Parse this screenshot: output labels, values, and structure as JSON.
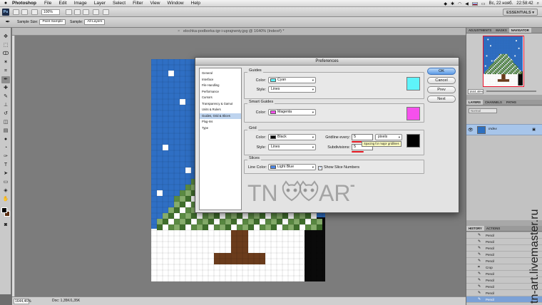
{
  "menubar": {
    "apple": "",
    "app_name": "Photoshop",
    "items": [
      "File",
      "Edit",
      "Image",
      "Layer",
      "Select",
      "Filter",
      "View",
      "Window",
      "Help"
    ],
    "status_right": [
      "Вс, 22 нояб.",
      "22:58:42"
    ]
  },
  "appbar": {
    "logo": "Ps",
    "zoom": "100%",
    "workspace": "ESSENTIALS ▾"
  },
  "options_bar": {
    "sample_size_label": "Sample Size:",
    "sample_size_value": "Point Sample",
    "sample_label": "Sample:",
    "sample_value": "All Layers"
  },
  "document": {
    "tab_title": "elochka-podborka-igr-i-uprajneniy.jpg @ 1640% (Index#) *",
    "status_zoom": "1644,46%",
    "status_doc": "Doc: 1,35K/1,35K"
  },
  "preferences": {
    "title": "Preferences",
    "categories": [
      {
        "label": "General",
        "selected": false
      },
      {
        "label": "Interface",
        "selected": false
      },
      {
        "label": "File Handling",
        "selected": false
      },
      {
        "label": "Performance",
        "selected": false
      },
      {
        "label": "Cursors",
        "selected": false
      },
      {
        "label": "Transparency & Gamut",
        "selected": false
      },
      {
        "label": "Units & Rulers",
        "selected": false
      },
      {
        "label": "Guides, Grid & Slices",
        "selected": true
      },
      {
        "label": "Plug-Ins",
        "selected": false
      },
      {
        "label": "Type",
        "selected": false
      }
    ],
    "guides": {
      "title": "Guides",
      "color_label": "Color:",
      "color_value": "Cyan",
      "color_hex": "#5ef3fa",
      "style_label": "Style:",
      "style_value": "Lines"
    },
    "smart_guides": {
      "title": "Smart Guides",
      "color_label": "Color:",
      "color_value": "Magenta",
      "color_hex": "#f550ec"
    },
    "grid": {
      "title": "Grid",
      "color_label": "Color:",
      "color_value": "Black",
      "color_hex": "#000000",
      "style_label": "Style:",
      "style_value": "Lines",
      "gridline_label": "Gridline every:",
      "gridline_value": "5",
      "gridline_unit": "pixels",
      "subdivisions_label": "Subdivisions:",
      "subdivisions_value": "5",
      "tooltip": "Spacing for major gridlines"
    },
    "slices": {
      "title": "Slices",
      "line_color_label": "Line Color:",
      "line_color_value": "Light Blue",
      "line_color_hex": "#4a86e8",
      "show_numbers_label": "Show Slice Numbers",
      "show_numbers_checked": true
    },
    "buttons": {
      "ok": "OK",
      "cancel": "Cancel",
      "prev": "Prev",
      "next": "Next"
    }
  },
  "panels": {
    "navigator_tabs": [
      "ADJUSTMENTS",
      "MASKS",
      "NAVIGATOR"
    ],
    "navigator_zoom": "1644,46%",
    "layers_tabs": [
      "LAYERS",
      "CHANNELS",
      "PATHS"
    ],
    "blend_mode": "Normal",
    "layer_name": "Index",
    "history_tabs": [
      "HISTORY",
      "ACTIONS"
    ],
    "history_items": [
      {
        "icon": "pencil-icon",
        "label": "Pencil",
        "selected": false
      },
      {
        "icon": "pencil-icon",
        "label": "Pencil",
        "selected": false
      },
      {
        "icon": "pencil-icon",
        "label": "Pencil",
        "selected": false
      },
      {
        "icon": "pencil-icon",
        "label": "Pencil",
        "selected": false
      },
      {
        "icon": "pencil-icon",
        "label": "Pencil",
        "selected": false
      },
      {
        "icon": "crop-icon",
        "label": "Crop",
        "selected": false
      },
      {
        "icon": "pencil-icon",
        "label": "Pencil",
        "selected": false
      },
      {
        "icon": "pencil-icon",
        "label": "Pencil",
        "selected": false
      },
      {
        "icon": "pencil-icon",
        "label": "Pencil",
        "selected": false
      },
      {
        "icon": "pencil-icon",
        "label": "Pencil",
        "selected": false
      },
      {
        "icon": "pencil-icon",
        "label": "Pencil",
        "selected": true
      }
    ]
  },
  "watermark": {
    "text": "TN  ART",
    "side_text": "tn-art.livemaster.ru"
  },
  "colors": {
    "sky": "#2f6fc4",
    "tree_dark": "#3f6e2c",
    "tree_light": "#86ad6b",
    "trunk": "#6b3c1c",
    "accent_red": "#e0141e"
  }
}
